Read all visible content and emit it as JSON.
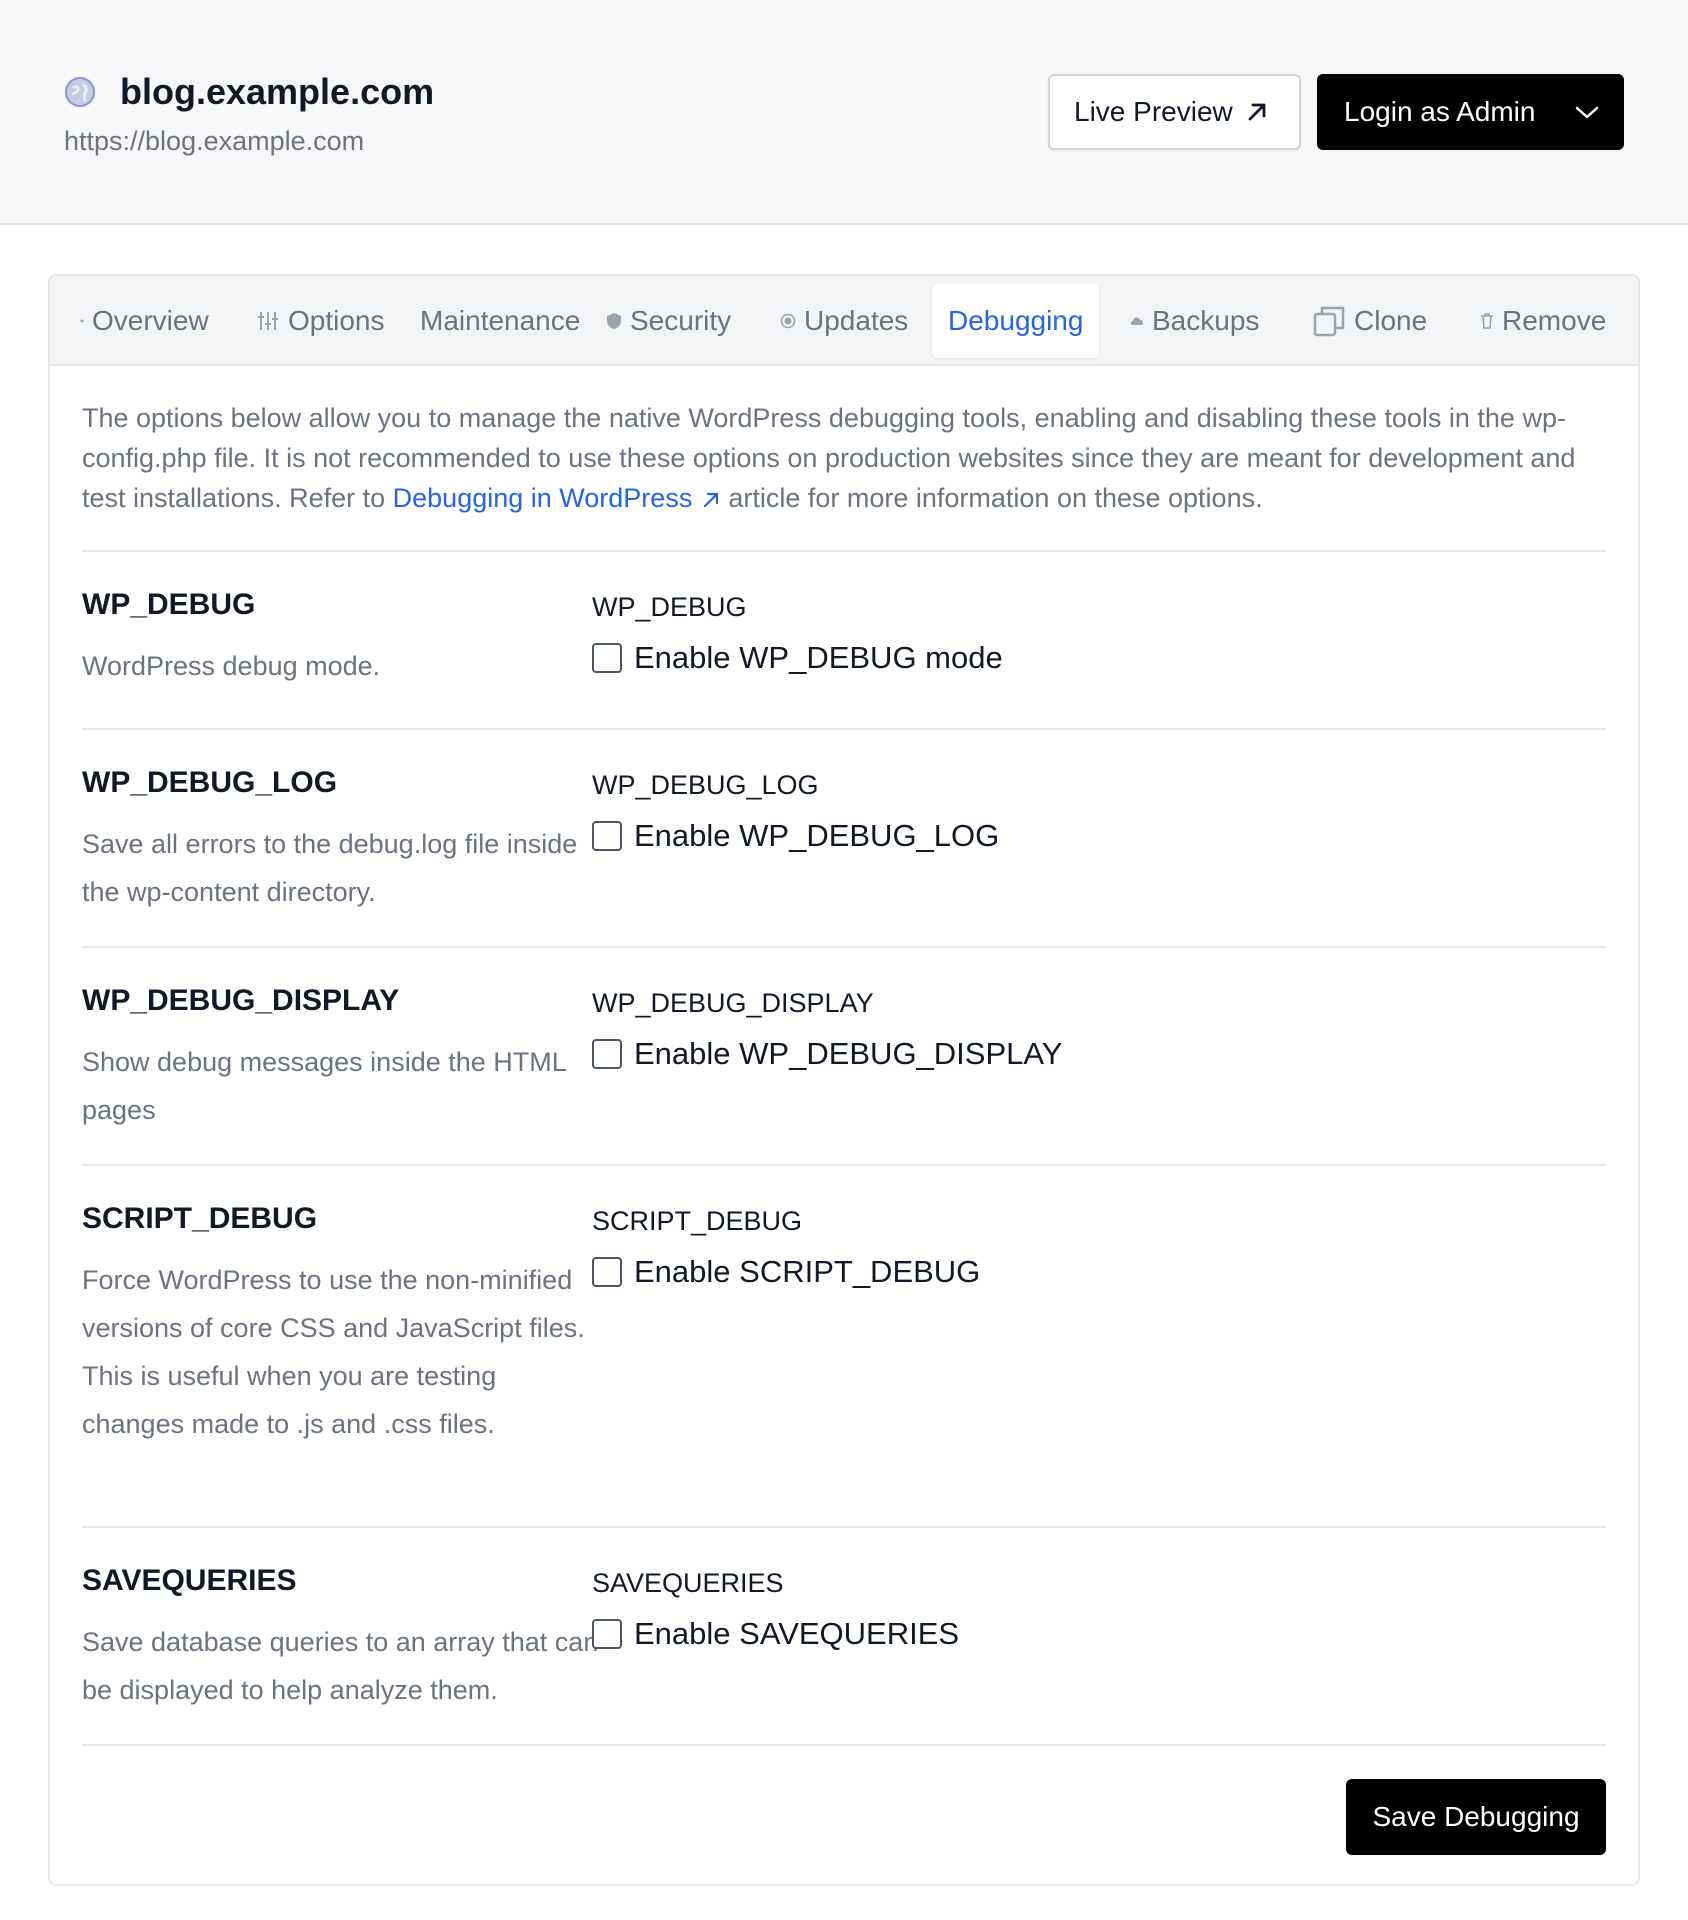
{
  "header": {
    "site_title": "blog.example.com",
    "site_url": "https://blog.example.com",
    "live_preview_label": "Live Preview",
    "login_admin_label": "Login as Admin"
  },
  "tabs": [
    {
      "label": "Overview",
      "icon": "dot-icon"
    },
    {
      "label": "Options",
      "icon": "sliders-icon"
    },
    {
      "label": "Maintenance",
      "icon": "none"
    },
    {
      "label": "Security",
      "icon": "shield-icon"
    },
    {
      "label": "Updates",
      "icon": "radio-icon"
    },
    {
      "label": "Debugging",
      "icon": "none",
      "active": true
    },
    {
      "label": "Backups",
      "icon": "cloud-icon"
    },
    {
      "label": "Clone",
      "icon": "copy-icon"
    },
    {
      "label": "Remove",
      "icon": "trash-icon"
    }
  ],
  "intro": {
    "text_before": "The options below allow you to manage the native WordPress debugging tools, enabling and disabling these tools in the wp-config.php file. It is not recommended to use these options on production websites since they are meant for development and test installations. Refer to ",
    "link_text": "Debugging in WordPress",
    "text_after": "article for more information on these options."
  },
  "settings": [
    {
      "title": "WP_DEBUG",
      "description": "WordPress debug mode.",
      "field_label": "WP_DEBUG",
      "checkbox_label": "Enable WP_DEBUG mode",
      "checked": false
    },
    {
      "title": "WP_DEBUG_LOG",
      "description": "Save all errors to the debug.log file inside the wp-content directory.",
      "field_label": "WP_DEBUG_LOG",
      "checkbox_label": "Enable WP_DEBUG_LOG",
      "checked": false
    },
    {
      "title": "WP_DEBUG_DISPLAY",
      "description": "Show debug messages inside the HTML pages",
      "field_label": "WP_DEBUG_DISPLAY",
      "checkbox_label": "Enable WP_DEBUG_DISPLAY",
      "checked": false
    },
    {
      "title": "SCRIPT_DEBUG",
      "description": "Force WordPress to use the non-minified versions of core CSS and JavaScript files. This is useful when you are testing changes made to .js and .css files.",
      "field_label": "SCRIPT_DEBUG",
      "checkbox_label": "Enable SCRIPT_DEBUG",
      "checked": false
    },
    {
      "title": "SAVEQUERIES",
      "description": "Save database queries to an array that can be displayed to help analyze them.",
      "field_label": "SAVEQUERIES",
      "checkbox_label": "Enable SAVEQUERIES",
      "checked": false
    }
  ],
  "save_label": "Save Debugging",
  "colors": {
    "accent": "#2563eb",
    "primary_button": "#000000",
    "muted_text": "#6b7280",
    "header_bg": "#f7f7f9"
  }
}
